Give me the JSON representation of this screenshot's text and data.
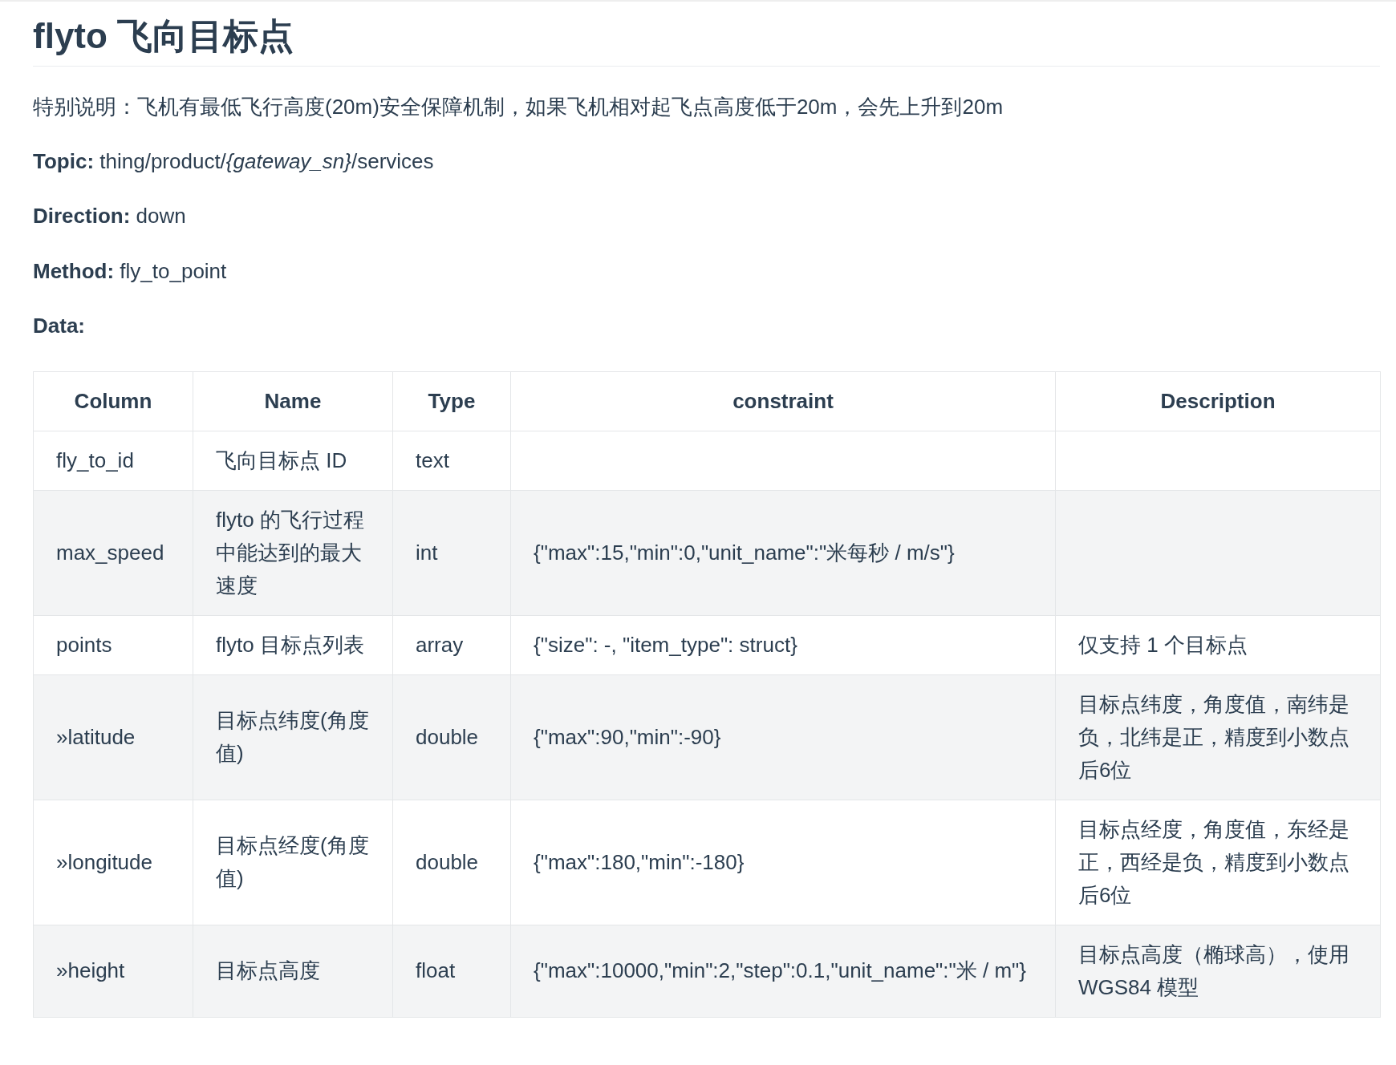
{
  "title": "flyto 飞向目标点",
  "note": "特别说明：飞机有最低飞行高度(20m)安全保障机制，如果飞机相对起飞点高度低于20m，会先上升到20m",
  "fields": [
    "**Topic:** thing/product/*{gateway_sn}*/services",
    "**Direction:** down",
    "**Method:** fly_to_point",
    "**Data:**"
  ],
  "table": {
    "columns": [
      "Column",
      "Name",
      "Type",
      "constraint",
      "Description"
    ],
    "rows": [
      [
        "fly_to_id",
        "飞向目标点 ID",
        "text",
        "",
        ""
      ],
      [
        "max_speed",
        "flyto 的飞行过程中能达到的最大速度",
        "int",
        "{\"max\":15,\"min\":0,\"unit_name\":\"米每秒 / m/s\"}",
        ""
      ],
      [
        "points",
        "flyto 目标点列表",
        "array",
        "{\"size\": -, \"item_type\": struct}",
        "仅支持 1 个目标点"
      ],
      [
        "»latitude",
        "目标点纬度(角度值)",
        "double",
        "{\"max\":90,\"min\":-90}",
        "目标点纬度，角度值，南纬是负，北纬是正，精度到小数点后6位"
      ],
      [
        "»longitude",
        "目标点经度(角度值)",
        "double",
        "{\"max\":180,\"min\":-180}",
        "目标点经度，角度值，东经是正，西经是负，精度到小数点后6位"
      ],
      [
        "»height",
        "目标点高度",
        "float",
        "{\"max\":10000,\"min\":2,\"step\":0.1,\"unit_name\":\"米 / m\"}",
        "目标点高度（椭球高），使用 WGS84 模型"
      ]
    ]
  }
}
